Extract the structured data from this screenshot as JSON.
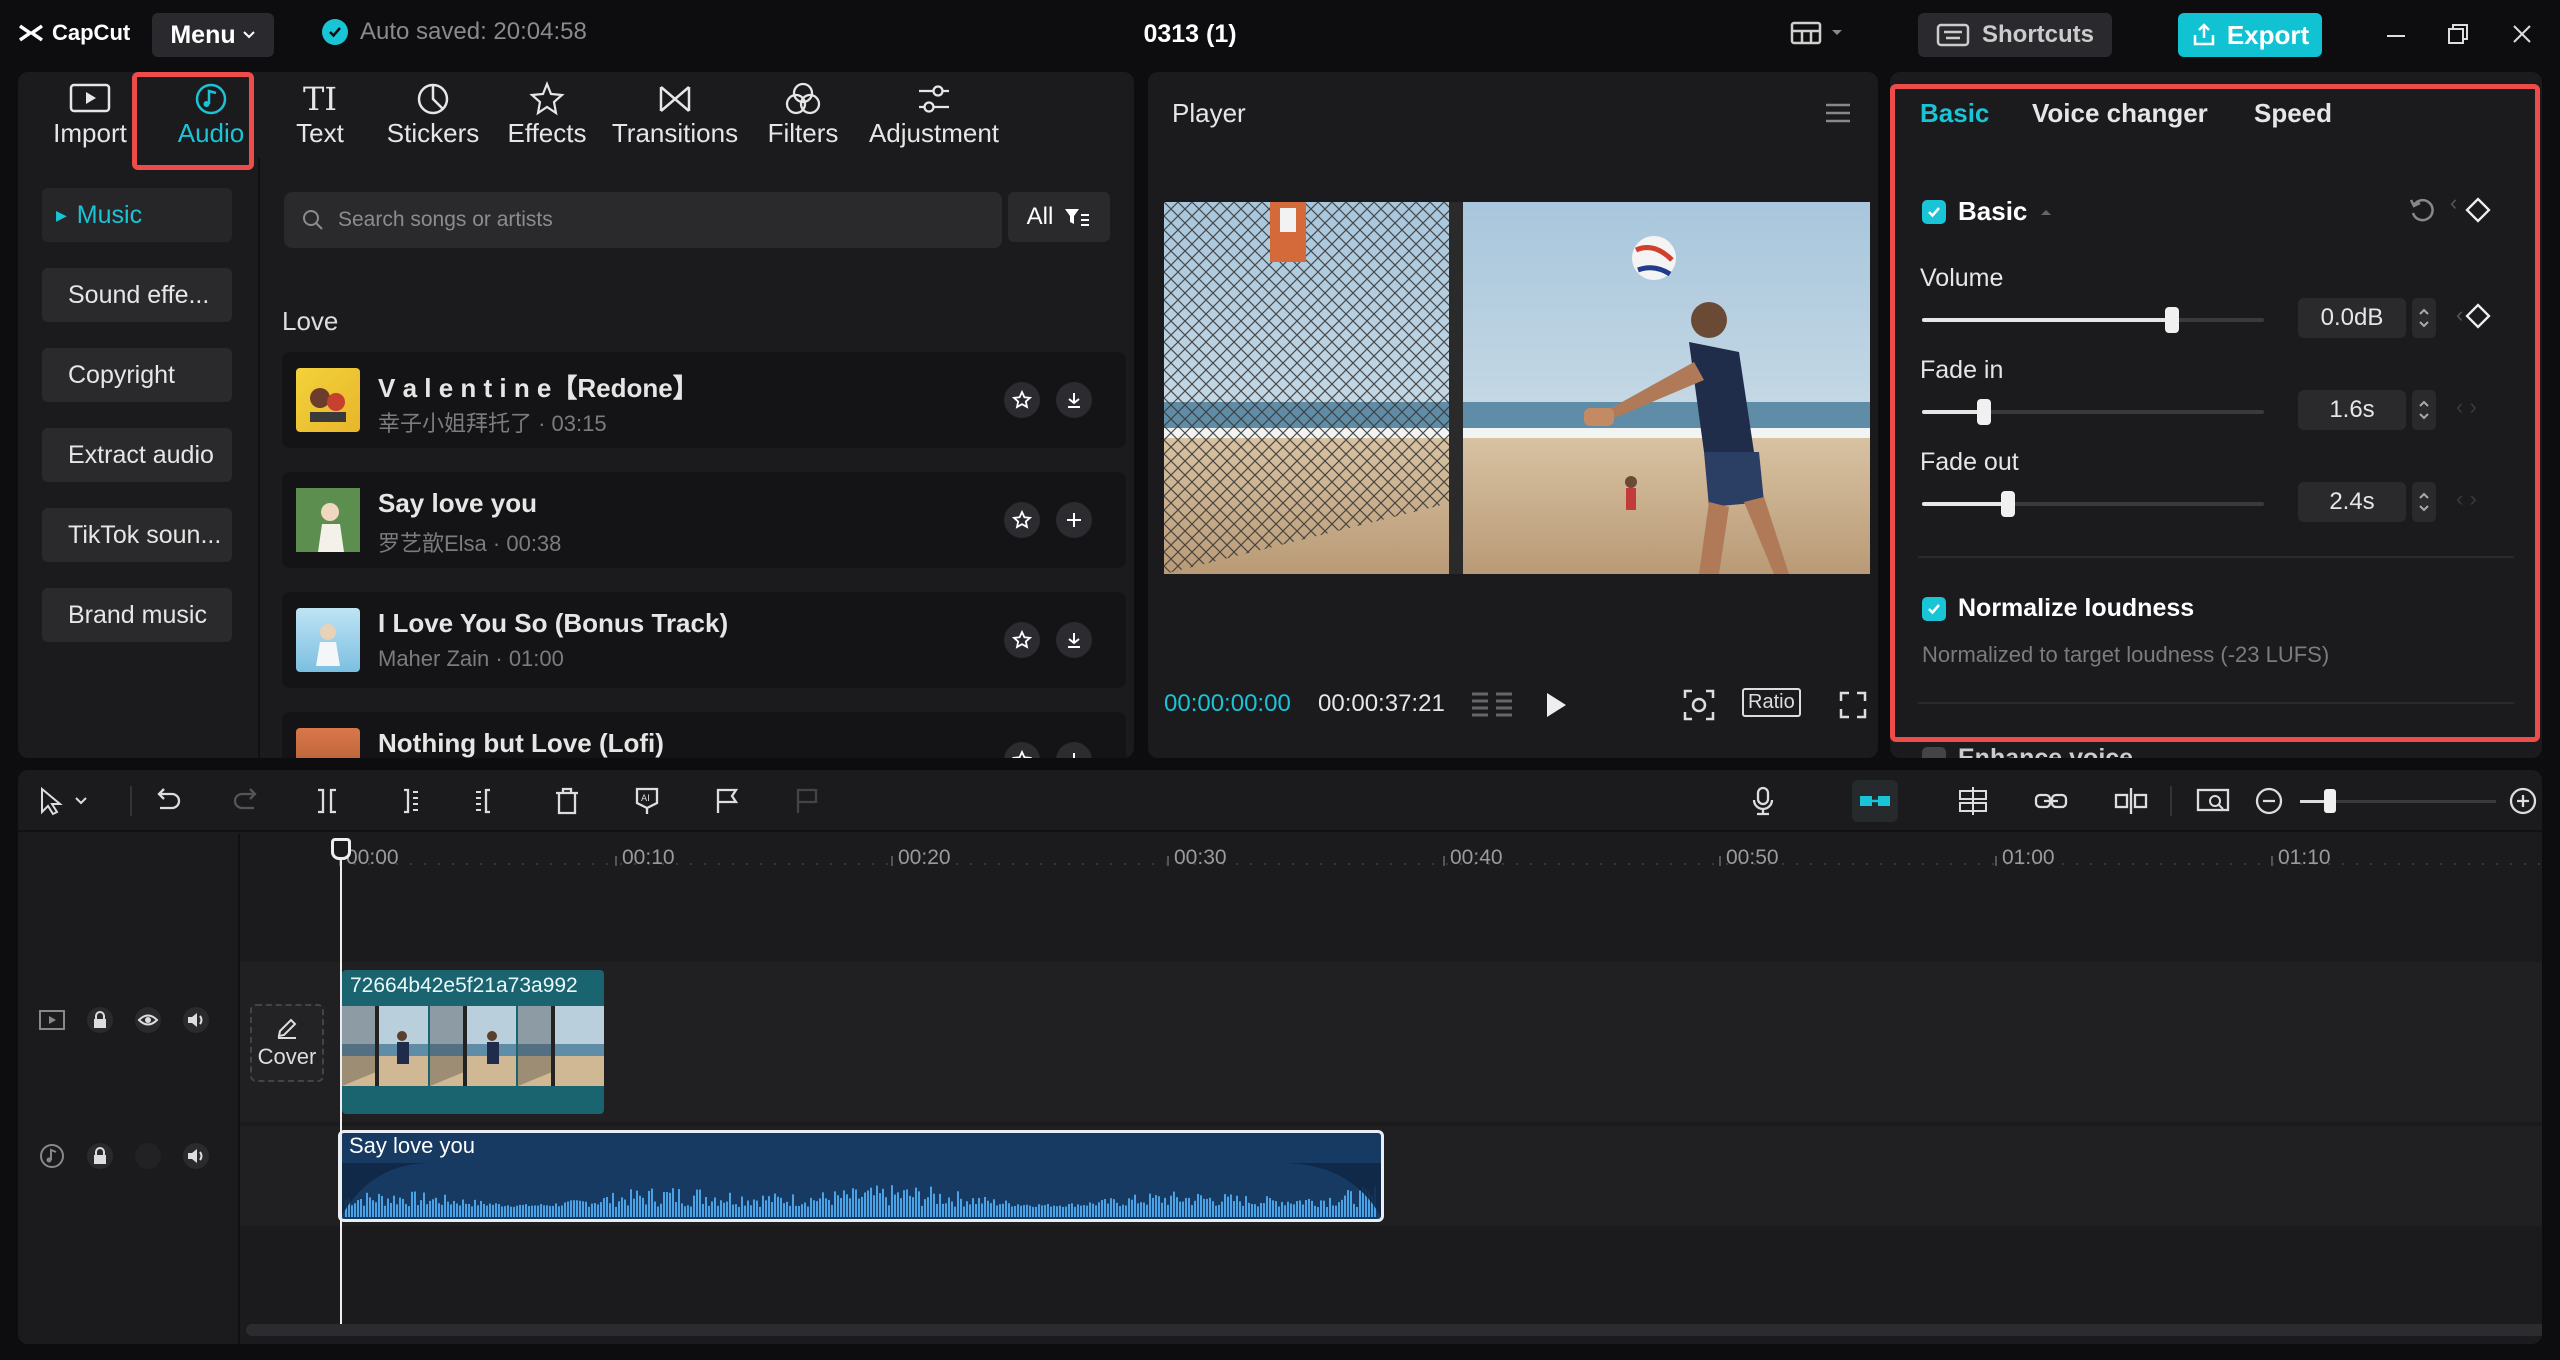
{
  "app": {
    "logo_text": "CapCut",
    "menu_label": "Menu",
    "autosave_text": "Auto saved: 20:04:58",
    "project_title": "0313 (1)",
    "shortcuts_label": "Shortcuts",
    "export_label": "Export"
  },
  "toolbar": {
    "items": [
      {
        "label": "Import",
        "icon": "import-icon"
      },
      {
        "label": "Audio",
        "icon": "music-note-icon",
        "active": true
      },
      {
        "label": "Text",
        "icon": "text-icon"
      },
      {
        "label": "Stickers",
        "icon": "sticker-icon"
      },
      {
        "label": "Effects",
        "icon": "effects-star-icon"
      },
      {
        "label": "Transitions",
        "icon": "transitions-icon"
      },
      {
        "label": "Filters",
        "icon": "filters-icon"
      },
      {
        "label": "Adjustment",
        "icon": "adjustment-sliders-icon"
      }
    ]
  },
  "sidebar": {
    "items": [
      {
        "label": "Music",
        "active": true
      },
      {
        "label": "Sound effe..."
      },
      {
        "label": "Copyright"
      },
      {
        "label": "Extract audio"
      },
      {
        "label": "TikTok soun..."
      },
      {
        "label": "Brand music"
      }
    ]
  },
  "search": {
    "placeholder": "Search songs or artists",
    "filter_label": "All"
  },
  "music": {
    "category": "Love",
    "songs": [
      {
        "title": "V a l e n t i n e【Redone】",
        "subtitle": "幸子小姐拜托了 · 03:15",
        "action": "download"
      },
      {
        "title": "Say love you",
        "subtitle": "罗艺歆Elsa · 00:38",
        "action": "add"
      },
      {
        "title": "I Love You So (Bonus Track)",
        "subtitle": "Maher Zain · 01:00",
        "action": "download"
      },
      {
        "title": "Nothing but Love (Lofi)",
        "subtitle": "",
        "action": "download"
      }
    ]
  },
  "player": {
    "title": "Player",
    "current_time": "00:00:00:00",
    "total_time": "00:00:37:21",
    "ratio_label": "Ratio"
  },
  "inspector": {
    "tabs": [
      "Basic",
      "Voice changer",
      "Speed"
    ],
    "active_tab": "Basic",
    "section_title": "Basic",
    "volume": {
      "label": "Volume",
      "value": "0.0dB",
      "level": 0.73
    },
    "fade_in": {
      "label": "Fade in",
      "value": "1.6s",
      "level": 0.18
    },
    "fade_out": {
      "label": "Fade out",
      "value": "2.4s",
      "level": 0.25
    },
    "normalize": {
      "label": "Normalize loudness",
      "description": "Normalized to target loudness (-23 LUFS)"
    },
    "next_section_label": "Enhance voice"
  },
  "timeline": {
    "ruler": [
      "00:00",
      "00:10",
      "00:20",
      "00:30",
      "00:40",
      "00:50",
      "01:00",
      "01:10"
    ],
    "cover_label": "Cover",
    "video_clip_name": "72664b42e5f21a73a992",
    "audio_clip_name": "Say love you"
  },
  "colors": {
    "accent": "#19c4d7",
    "highlight_box": "#ee4b4b",
    "audio_clip": "#173a63",
    "video_clip": "#1a6470"
  }
}
